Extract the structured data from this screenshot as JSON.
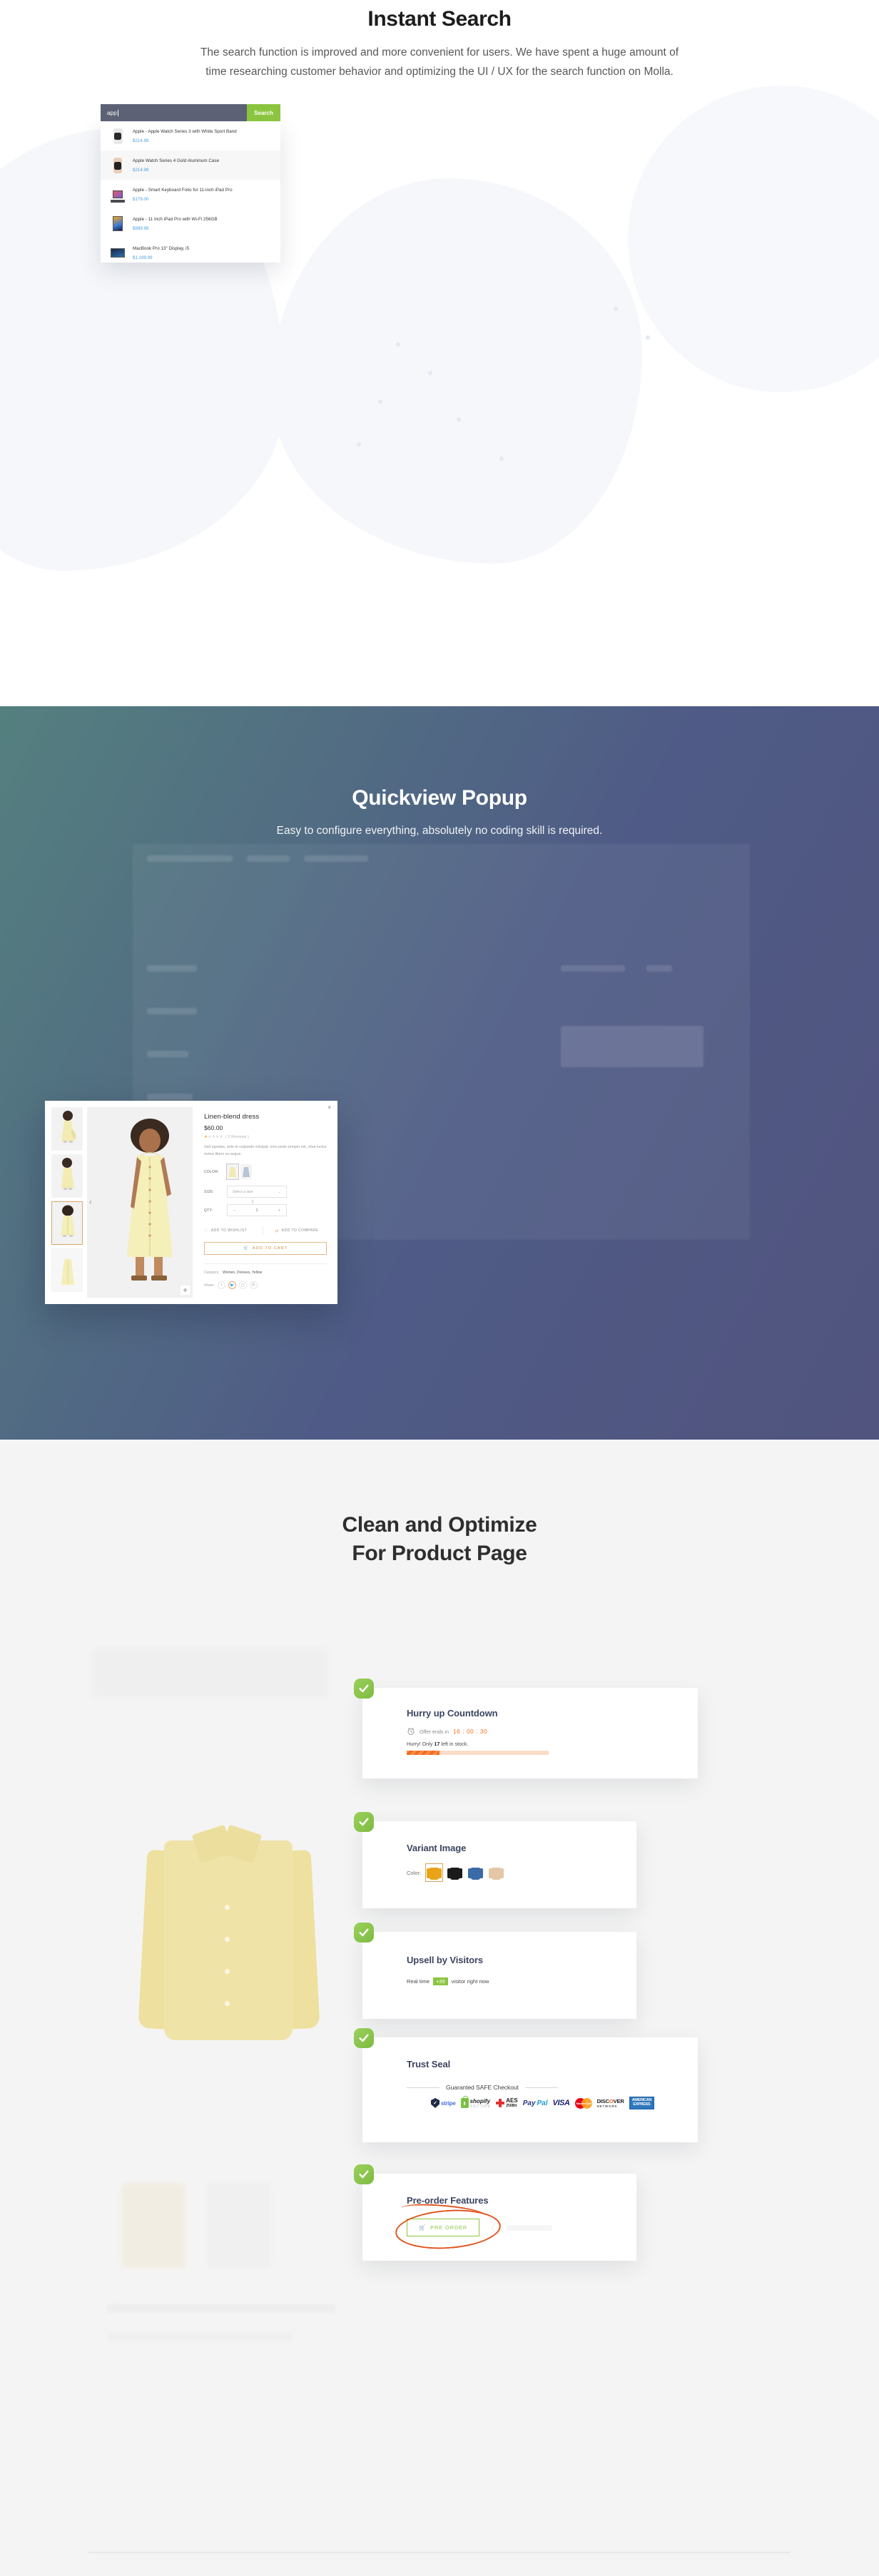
{
  "search_section": {
    "title": "Instant Search",
    "description": "The search function is improved and more convenient for users. We have spent a huge amount of time researching customer behavior and optimizing the UI / UX for the search function on Molla.",
    "search_value": "app",
    "search_button": "Search",
    "results": [
      {
        "name": "Apple - Apple Watch Series 3 with White Sport Band",
        "price": "$214.99"
      },
      {
        "name": "Apple Watch Series 4 Gold Aluminum Case",
        "price": "$214.99"
      },
      {
        "name": "Apple - Smart Keyboard Folio for 11-inch iPad Pro",
        "price": "$179.00"
      },
      {
        "name": "Apple - 11 Inch iPad Pro with Wi-Fi 256GB",
        "price": "$899.99"
      },
      {
        "name": "MacBook Pro 13\" Display, i5",
        "price": "$1,199.99"
      }
    ]
  },
  "quickview_section": {
    "title": "Quickview Popup",
    "description": "Easy to configure everything, absolutely no coding skill is required.",
    "close_label": "×",
    "product": {
      "name": "Linen-blend dress",
      "price": "$60.00",
      "reviews": "( 2 Reviews )",
      "stars_filled": 1,
      "stars_total": 5,
      "description": "Sed egestas, ante et vulputate volutpat, eros pede semper est, vitae luctus metus libero eu augue.",
      "color_label": "COLOR:",
      "size_label": "SIZE:",
      "size_placeholder": "Select a size",
      "qty_label": "QTY:",
      "qty_value": "1",
      "qty_minus": "−",
      "qty_plus": "+",
      "wishlist_label": "ADD TO WISHLIST",
      "compare_label": "ADD TO COMPARE",
      "add_to_cart_label": "ADD TO CART",
      "category_label": "Category:",
      "category_value": "Women, Dresses, Yellow",
      "share_label": "Share:",
      "share_networks": [
        "f",
        "ᴛ",
        "◎",
        "Ⓟ"
      ]
    }
  },
  "clean_section": {
    "title_line1": "Clean and Optimize",
    "title_line2": "For Product Page",
    "cards": [
      {
        "title": "Hurry up Countdown",
        "offer_text": "Offer ends in",
        "timer": "16 : 00 : 30",
        "stock_prefix": "Hurry! Only",
        "stock_count": "17",
        "stock_suffix": "left in stock.",
        "progress_percent": 23
      },
      {
        "title": "Variant Image",
        "color_label": "Color:",
        "swatches": [
          {
            "name": "mustard",
            "color": "#e8a317"
          },
          {
            "name": "black",
            "color": "#1a1a1a"
          },
          {
            "name": "blue-denim",
            "color": "#3b6aa8"
          },
          {
            "name": "beige",
            "color": "#e3c7a6"
          }
        ],
        "selected_index": 0
      },
      {
        "title": "Upsell by Visitors",
        "prefix": "Real time",
        "badge": "+39",
        "suffix": "visitor right now"
      },
      {
        "title": "Trust Seal",
        "seal_text": "Guaranted SAFE Checkout",
        "badges": [
          "stripe",
          "shopify SECURE",
          "AES 256Bit",
          "PayPal",
          "VISA",
          "MasterCard",
          "DISCOVER NETWORK",
          "AMERICAN EXPRESS"
        ]
      },
      {
        "title": "Pre-order Features",
        "button_label": "PRE ORDER"
      }
    ]
  },
  "colors": {
    "accent_green": "#8bc53f",
    "search_bar_bg": "#5c6176",
    "price_blue": "#4a9fe0",
    "countdown_orange": "#f26c1f",
    "cart_border": "#e3b98a",
    "gradient_start": "#54807f",
    "gradient_end": "#50547e",
    "card_title": "#3c4560"
  }
}
